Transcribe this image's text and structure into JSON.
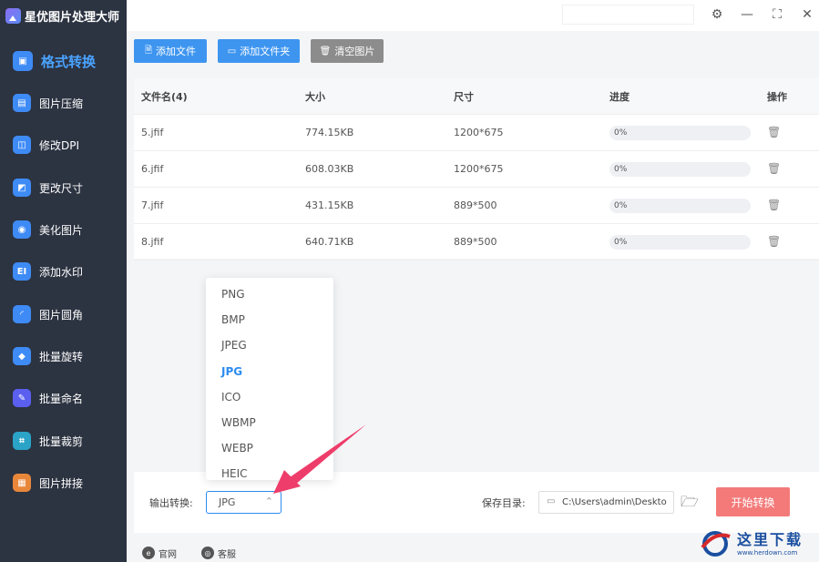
{
  "app": {
    "title": "星优图片处理大师"
  },
  "sidebar": {
    "items": [
      {
        "label": "格式转换",
        "icon": "image-convert-icon",
        "color": "#3e8bf6",
        "glyph": "▣"
      },
      {
        "label": "图片压缩",
        "icon": "compress-icon",
        "color": "#3e8bf6",
        "glyph": "▤"
      },
      {
        "label": "修改DPI",
        "icon": "dpi-icon",
        "color": "#3e8bf6",
        "glyph": "◫"
      },
      {
        "label": "更改尺寸",
        "icon": "resize-icon",
        "color": "#3e8bf6",
        "glyph": "◩"
      },
      {
        "label": "美化图片",
        "icon": "beautify-icon",
        "color": "#3e8bf6",
        "glyph": "◉"
      },
      {
        "label": "添加水印",
        "icon": "watermark-icon",
        "color": "#3e8bf6",
        "glyph": "EI"
      },
      {
        "label": "图片圆角",
        "icon": "round-corner-icon",
        "color": "#3e8bf6",
        "glyph": "◜"
      },
      {
        "label": "批量旋转",
        "icon": "rotate-icon",
        "color": "#3e8bf6",
        "glyph": "◆"
      },
      {
        "label": "批量命名",
        "icon": "rename-icon",
        "color": "#5a5ff0",
        "glyph": "✎"
      },
      {
        "label": "批量裁剪",
        "icon": "crop-icon",
        "color": "#2aa3c7",
        "glyph": "⌗"
      },
      {
        "label": "图片拼接",
        "icon": "stitch-icon",
        "color": "#e8873a",
        "glyph": "▦"
      }
    ]
  },
  "window": {
    "settings": "⚙",
    "minimize": "—",
    "maximize": "⛶",
    "close": "✕"
  },
  "toolbar": {
    "add_file": "添加文件",
    "add_folder": "添加文件夹",
    "clear": "清空图片"
  },
  "table": {
    "headers": {
      "name": "文件名(4)",
      "size": "大小",
      "dimensions": "尺寸",
      "progress": "进度",
      "actions": "操作"
    },
    "rows": [
      {
        "name": "5.jfif",
        "size": "774.15KB",
        "dimensions": "1200*675",
        "progress": "0%"
      },
      {
        "name": "6.jfif",
        "size": "608.03KB",
        "dimensions": "1200*675",
        "progress": "0%"
      },
      {
        "name": "7.jfif",
        "size": "431.15KB",
        "dimensions": "889*500",
        "progress": "0%"
      },
      {
        "name": "8.jfif",
        "size": "640.71KB",
        "dimensions": "889*500",
        "progress": "0%"
      }
    ]
  },
  "dropdown": {
    "options": [
      "PNG",
      "BMP",
      "JPEG",
      "JPG",
      "ICO",
      "WBMP",
      "WEBP",
      "HEIC"
    ],
    "selected": "JPG"
  },
  "bottom": {
    "output_label": "输出转换:",
    "output_value": "JPG",
    "save_label": "保存目录:",
    "save_path": "C:\\Users\\admin\\Deskto",
    "start": "开始转换"
  },
  "footer": {
    "website": "官网",
    "support": "客服"
  },
  "colors": {
    "accent": "#2d8cf0",
    "start_button": "#f47a7a",
    "sidebar": "#2c3341",
    "arrow": "#ee3d6a"
  },
  "watermark": {
    "text": "这里下载",
    "url": "www.herdown.com"
  }
}
